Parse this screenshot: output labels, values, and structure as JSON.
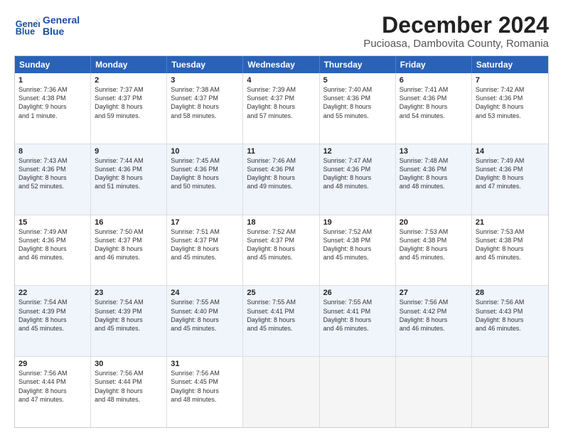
{
  "logo": {
    "line1": "General",
    "line2": "Blue"
  },
  "title": "December 2024",
  "subtitle": "Pucioasa, Dambovita County, Romania",
  "header_days": [
    "Sunday",
    "Monday",
    "Tuesday",
    "Wednesday",
    "Thursday",
    "Friday",
    "Saturday"
  ],
  "rows": [
    {
      "alt": false,
      "cells": [
        {
          "day": "1",
          "info": "Sunrise: 7:36 AM\nSunset: 4:38 PM\nDaylight: 9 hours\nand 1 minute."
        },
        {
          "day": "2",
          "info": "Sunrise: 7:37 AM\nSunset: 4:37 PM\nDaylight: 8 hours\nand 59 minutes."
        },
        {
          "day": "3",
          "info": "Sunrise: 7:38 AM\nSunset: 4:37 PM\nDaylight: 8 hours\nand 58 minutes."
        },
        {
          "day": "4",
          "info": "Sunrise: 7:39 AM\nSunset: 4:37 PM\nDaylight: 8 hours\nand 57 minutes."
        },
        {
          "day": "5",
          "info": "Sunrise: 7:40 AM\nSunset: 4:36 PM\nDaylight: 8 hours\nand 55 minutes."
        },
        {
          "day": "6",
          "info": "Sunrise: 7:41 AM\nSunset: 4:36 PM\nDaylight: 8 hours\nand 54 minutes."
        },
        {
          "day": "7",
          "info": "Sunrise: 7:42 AM\nSunset: 4:36 PM\nDaylight: 8 hours\nand 53 minutes."
        }
      ]
    },
    {
      "alt": true,
      "cells": [
        {
          "day": "8",
          "info": "Sunrise: 7:43 AM\nSunset: 4:36 PM\nDaylight: 8 hours\nand 52 minutes."
        },
        {
          "day": "9",
          "info": "Sunrise: 7:44 AM\nSunset: 4:36 PM\nDaylight: 8 hours\nand 51 minutes."
        },
        {
          "day": "10",
          "info": "Sunrise: 7:45 AM\nSunset: 4:36 PM\nDaylight: 8 hours\nand 50 minutes."
        },
        {
          "day": "11",
          "info": "Sunrise: 7:46 AM\nSunset: 4:36 PM\nDaylight: 8 hours\nand 49 minutes."
        },
        {
          "day": "12",
          "info": "Sunrise: 7:47 AM\nSunset: 4:36 PM\nDaylight: 8 hours\nand 48 minutes."
        },
        {
          "day": "13",
          "info": "Sunrise: 7:48 AM\nSunset: 4:36 PM\nDaylight: 8 hours\nand 48 minutes."
        },
        {
          "day": "14",
          "info": "Sunrise: 7:49 AM\nSunset: 4:36 PM\nDaylight: 8 hours\nand 47 minutes."
        }
      ]
    },
    {
      "alt": false,
      "cells": [
        {
          "day": "15",
          "info": "Sunrise: 7:49 AM\nSunset: 4:36 PM\nDaylight: 8 hours\nand 46 minutes."
        },
        {
          "day": "16",
          "info": "Sunrise: 7:50 AM\nSunset: 4:37 PM\nDaylight: 8 hours\nand 46 minutes."
        },
        {
          "day": "17",
          "info": "Sunrise: 7:51 AM\nSunset: 4:37 PM\nDaylight: 8 hours\nand 45 minutes."
        },
        {
          "day": "18",
          "info": "Sunrise: 7:52 AM\nSunset: 4:37 PM\nDaylight: 8 hours\nand 45 minutes."
        },
        {
          "day": "19",
          "info": "Sunrise: 7:52 AM\nSunset: 4:38 PM\nDaylight: 8 hours\nand 45 minutes."
        },
        {
          "day": "20",
          "info": "Sunrise: 7:53 AM\nSunset: 4:38 PM\nDaylight: 8 hours\nand 45 minutes."
        },
        {
          "day": "21",
          "info": "Sunrise: 7:53 AM\nSunset: 4:38 PM\nDaylight: 8 hours\nand 45 minutes."
        }
      ]
    },
    {
      "alt": true,
      "cells": [
        {
          "day": "22",
          "info": "Sunrise: 7:54 AM\nSunset: 4:39 PM\nDaylight: 8 hours\nand 45 minutes."
        },
        {
          "day": "23",
          "info": "Sunrise: 7:54 AM\nSunset: 4:39 PM\nDaylight: 8 hours\nand 45 minutes."
        },
        {
          "day": "24",
          "info": "Sunrise: 7:55 AM\nSunset: 4:40 PM\nDaylight: 8 hours\nand 45 minutes."
        },
        {
          "day": "25",
          "info": "Sunrise: 7:55 AM\nSunset: 4:41 PM\nDaylight: 8 hours\nand 45 minutes."
        },
        {
          "day": "26",
          "info": "Sunrise: 7:55 AM\nSunset: 4:41 PM\nDaylight: 8 hours\nand 46 minutes."
        },
        {
          "day": "27",
          "info": "Sunrise: 7:56 AM\nSunset: 4:42 PM\nDaylight: 8 hours\nand 46 minutes."
        },
        {
          "day": "28",
          "info": "Sunrise: 7:56 AM\nSunset: 4:43 PM\nDaylight: 8 hours\nand 46 minutes."
        }
      ]
    },
    {
      "alt": false,
      "cells": [
        {
          "day": "29",
          "info": "Sunrise: 7:56 AM\nSunset: 4:44 PM\nDaylight: 8 hours\nand 47 minutes."
        },
        {
          "day": "30",
          "info": "Sunrise: 7:56 AM\nSunset: 4:44 PM\nDaylight: 8 hours\nand 48 minutes."
        },
        {
          "day": "31",
          "info": "Sunrise: 7:56 AM\nSunset: 4:45 PM\nDaylight: 8 hours\nand 48 minutes."
        },
        {
          "day": "",
          "info": ""
        },
        {
          "day": "",
          "info": ""
        },
        {
          "day": "",
          "info": ""
        },
        {
          "day": "",
          "info": ""
        }
      ]
    }
  ]
}
